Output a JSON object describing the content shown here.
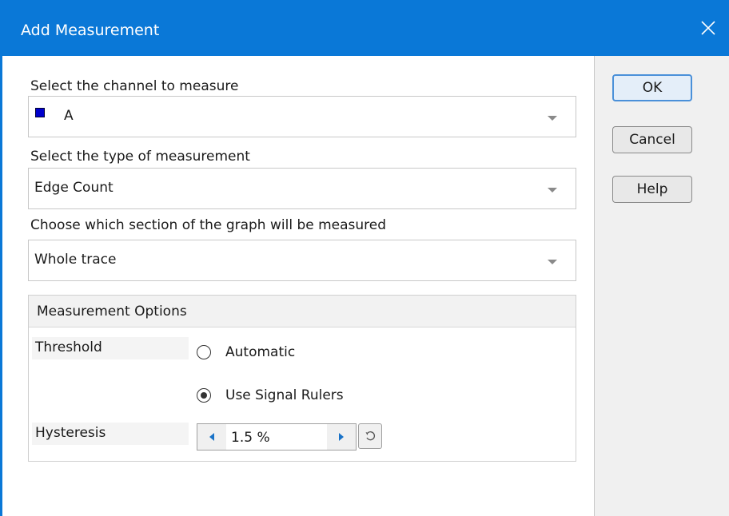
{
  "dialog": {
    "title": "Add Measurement"
  },
  "buttons": {
    "ok_label": "OK",
    "cancel_label": "Cancel",
    "help_label": "Help"
  },
  "channel": {
    "label": "Select the channel to measure",
    "value": "A",
    "swatch_color": "#0000cc"
  },
  "measurement_type": {
    "label": "Select the type of measurement",
    "value": "Edge Count"
  },
  "section": {
    "label": "Choose which section of the graph will be measured",
    "value": "Whole trace"
  },
  "options": {
    "title": "Measurement Options",
    "threshold_label": "Threshold",
    "automatic_label": "Automatic",
    "signal_rulers_label": "Use Signal Rulers",
    "selected_threshold": "Use Signal Rulers",
    "hysteresis_label": "Hysteresis",
    "hysteresis_value": "1.5 %"
  },
  "colors": {
    "title_bar": "#0a78d7",
    "spinner_arrow": "#1a73c8"
  }
}
